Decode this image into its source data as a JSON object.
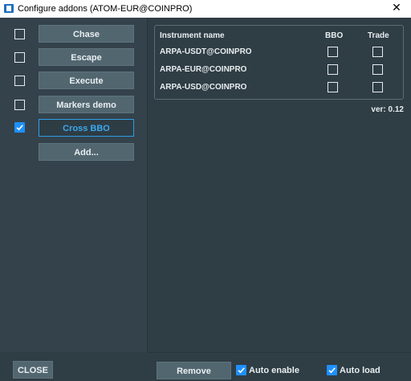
{
  "window": {
    "title": "Configure addons (ATOM-EUR@COINPRO)",
    "close_glyph": "✕"
  },
  "addons": [
    {
      "label": "Chase",
      "checked": false,
      "selected": false
    },
    {
      "label": "Escape",
      "checked": false,
      "selected": false
    },
    {
      "label": "Execute",
      "checked": false,
      "selected": false
    },
    {
      "label": "Markers demo",
      "checked": false,
      "selected": false
    },
    {
      "label": "Cross BBO",
      "checked": true,
      "selected": true
    }
  ],
  "add_button": "Add...",
  "instruments_table": {
    "headers": {
      "name": "Instrument name",
      "bbo": "BBO",
      "trade": "Trade"
    },
    "rows": [
      {
        "name": "ARPA-USDT@COINPRO",
        "bbo": false,
        "trade": false
      },
      {
        "name": "ARPA-EUR@COINPRO",
        "bbo": false,
        "trade": false
      },
      {
        "name": "ARPA-USD@COINPRO",
        "bbo": false,
        "trade": false
      }
    ]
  },
  "version_text": "ver: 0.12",
  "footer": {
    "close_label": "CLOSE",
    "remove_label": "Remove",
    "auto_enable_label": "Auto enable",
    "auto_enable_checked": true,
    "auto_load_label": "Auto load",
    "auto_load_checked": true
  },
  "colors": {
    "background": "#2f3d45",
    "button": "#526670",
    "accent": "#2d9fe8",
    "checkbox_checked": "#1e90ff"
  }
}
